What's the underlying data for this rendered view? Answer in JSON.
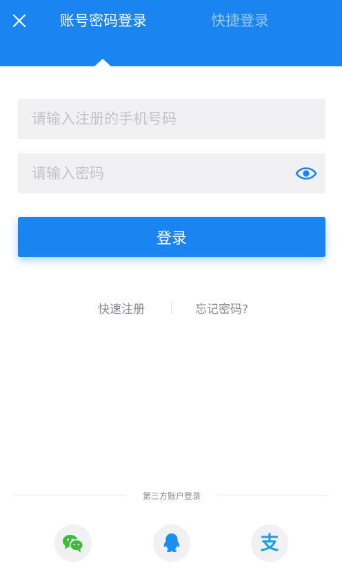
{
  "header": {
    "tabs": [
      {
        "label": "账号密码登录",
        "active": true
      },
      {
        "label": "快捷登录",
        "active": false
      }
    ]
  },
  "form": {
    "phone": {
      "placeholder": "请输入注册的手机号码",
      "value": ""
    },
    "password": {
      "placeholder": "请输入密码",
      "value": ""
    },
    "login_label": "登录"
  },
  "links": {
    "register": "快速注册",
    "forgot": "忘记密码?"
  },
  "third_party": {
    "title": "第三方账户登录",
    "providers": [
      {
        "icon": "wechat-icon"
      },
      {
        "icon": "qq-icon"
      },
      {
        "icon": "alipay-icon",
        "glyph": "支"
      }
    ]
  },
  "colors": {
    "primary": "#1a84f0",
    "input_bg": "#f1f1f3",
    "wechat": "#3fba3c",
    "qq": "#1a8ff0",
    "alipay": "#1a9ee6"
  }
}
